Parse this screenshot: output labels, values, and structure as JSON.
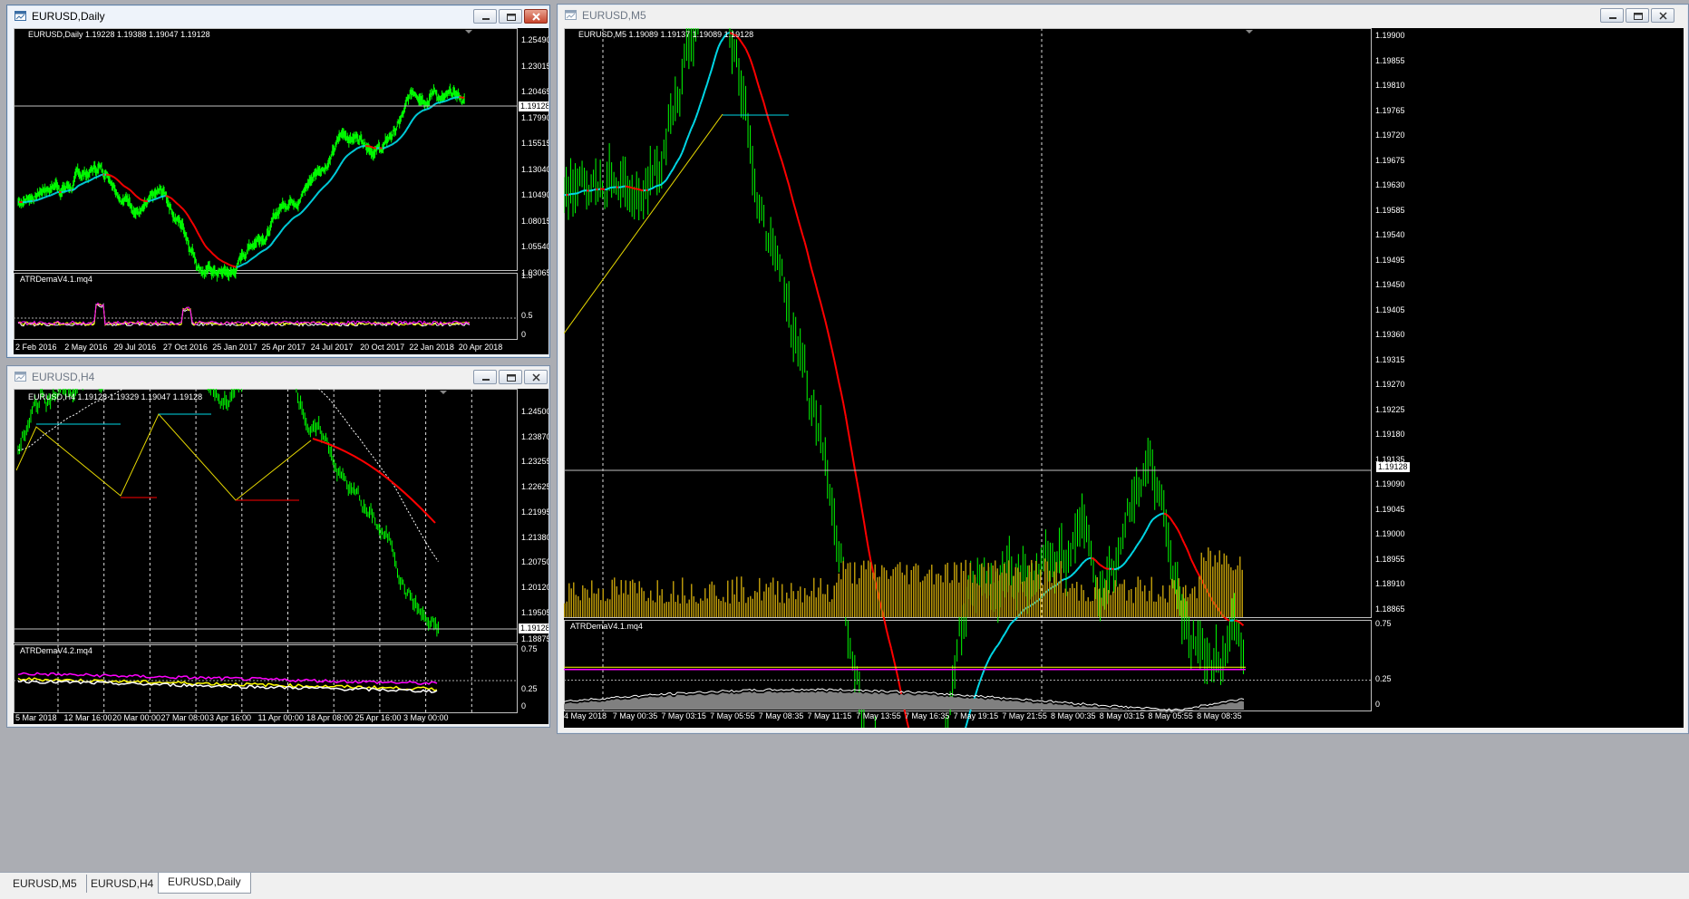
{
  "windows": {
    "daily": {
      "title": "EURUSD,Daily",
      "info": "EURUSD,Daily  1.19228 1.19388 1.19047 1.19128",
      "indicator": "ATRDemaV4.1.mq4",
      "price_axis": [
        "1.25490",
        "1.23015",
        "1.20465",
        "1.17990",
        "1.15515",
        "1.13040",
        "1.10490",
        "1.08015",
        "1.05540",
        "1.03065"
      ],
      "current_price": "1.19128",
      "ind_axis": [
        "1.5",
        "0.5",
        "0"
      ],
      "time_axis": [
        "2 Feb 2016",
        "2 May 2016",
        "29 Jul 2016",
        "27 Oct 2016",
        "25 Jan 2017",
        "25 Apr 2017",
        "24 Jul 2017",
        "20 Oct 2017",
        "22 Jan 2018",
        "20 Apr 2018"
      ]
    },
    "h4": {
      "title": "EURUSD,H4",
      "info": "EURUSD,H4  1.19128 1.19329 1.19047 1.19128",
      "indicator": "ATRDemaV4.2.mq4",
      "price_axis": [
        "1.24500",
        "1.23870",
        "1.23255",
        "1.22625",
        "1.21995",
        "1.21380",
        "1.20750",
        "1.20120",
        "1.19505"
      ],
      "current_price": "1.19128",
      "bottom_price": "1.18875",
      "ind_axis": [
        "0.75",
        "0.25",
        "0"
      ],
      "time_axis": [
        "5 Mar 2018",
        "12 Mar 16:00",
        "20 Mar 00:00",
        "27 Mar 08:00",
        "3 Apr 16:00",
        "11 Apr 00:00",
        "18 Apr 08:00",
        "25 Apr 16:00",
        "3 May 00:00"
      ]
    },
    "m5": {
      "title": "EURUSD,M5",
      "info": "EURUSD,M5  1.19089 1.19137 1.19089 1.19128",
      "indicator": "ATRDemaV4.1.mq4",
      "price_axis": [
        "1.19900",
        "1.19855",
        "1.19810",
        "1.19765",
        "1.19720",
        "1.19675",
        "1.19630",
        "1.19585",
        "1.19540",
        "1.19495",
        "1.19450",
        "1.19405",
        "1.19360",
        "1.19315",
        "1.19270",
        "1.19225",
        "1.19180",
        "1.19135",
        "1.19090",
        "1.19045",
        "1.19000",
        "1.18955",
        "1.18910",
        "1.18865"
      ],
      "current_price": "1.19128",
      "ind_axis": [
        "0.75",
        "0.25",
        "0"
      ],
      "time_axis": [
        "4 May 2018",
        "7 May 00:35",
        "7 May 03:15",
        "7 May 05:55",
        "7 May 08:35",
        "7 May 11:15",
        "7 May 13:55",
        "7 May 16:35",
        "7 May 19:15",
        "7 May 21:55",
        "8 May 00:35",
        "8 May 03:15",
        "8 May 05:55",
        "8 May 08:35"
      ]
    }
  },
  "tabs": [
    "EURUSD,M5",
    "EURUSD,H4",
    "EURUSD,Daily"
  ],
  "active_tab": "EURUSD,Daily",
  "colors": {
    "candle": "#00ff00",
    "dema_up": "#00d7e6",
    "dema_down": "#ff0000",
    "zigzag": "#e6d800",
    "volume": "#b8960a",
    "atr_magenta": "#ff00ff",
    "atr_yellow": "#ffff00",
    "atr_white": "#ffffff"
  }
}
